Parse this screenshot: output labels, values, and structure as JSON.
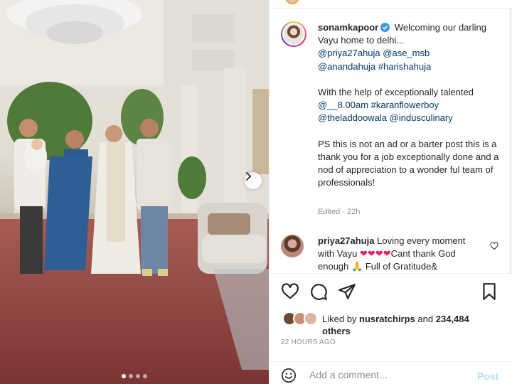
{
  "post": {
    "username": "sonamkapoor",
    "verified": true,
    "caption_start": "Welcoming our darling Vayu home to delhi...",
    "tags_line1": [
      "@priya27ahuja",
      "@ase_msb"
    ],
    "tags_line2": [
      "@anandahuja",
      "#harishahuja"
    ],
    "para2_start": "With the help of exceptionally talented",
    "para2_tags": [
      "@__8.00am",
      "#karanflowerboy",
      "@theladdoowala",
      "@indusculinary"
    ],
    "para3": "PS this is not an ad or a barter post this is a thank you for a job exceptionally done and a nod of appreciation to a wonder ful team of professionals!",
    "edited": "Edited · 22h"
  },
  "comment": {
    "username": "priya27ahuja",
    "text_before": "Loving every moment with Vayu",
    "emoji_hearts": "❤❤❤❤",
    "text_after": "Cant thank God enough",
    "emoji_pray": "🙏",
    "text_tail": "Full of Gratitude&"
  },
  "likes": {
    "prefix": "Liked by",
    "user": "nusratchirps",
    "and": "and",
    "count": "234,484",
    "suffix": "others"
  },
  "timestamp": "22 HOURS AGO",
  "add_comment": {
    "placeholder": "Add a comment...",
    "post_label": "Post"
  },
  "icons": [
    "verified-icon",
    "heart-icon",
    "comment-icon",
    "share-icon",
    "bookmark-icon",
    "emoji-icon",
    "chevron-right-icon"
  ],
  "colors": {
    "link": "#00376b",
    "verified": "#3897f0",
    "post_disabled": "#b2dffc",
    "muted": "#8e8e8e",
    "heart": "#ed4956"
  },
  "carousel": {
    "slides": 4,
    "active": 1
  }
}
